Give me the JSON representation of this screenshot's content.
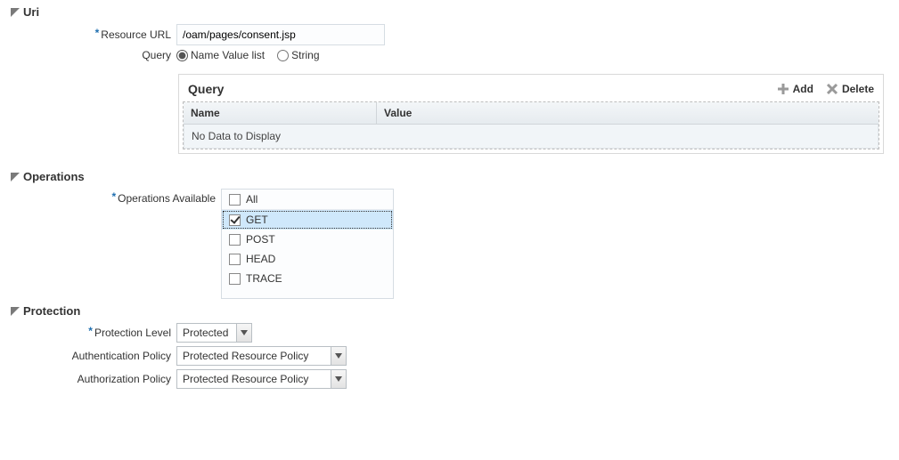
{
  "uri": {
    "section_title": "Uri",
    "resource_url_label": "Resource URL",
    "resource_url_value": "/oam/pages/consent.jsp",
    "query_label": "Query",
    "query_options": {
      "nvl": "Name Value list",
      "str": "String"
    },
    "query_selected": "nvl",
    "query_panel": {
      "title": "Query",
      "add_label": "Add",
      "delete_label": "Delete",
      "columns": {
        "name": "Name",
        "value": "Value"
      },
      "empty_text": "No Data to Display"
    }
  },
  "operations": {
    "section_title": "Operations",
    "available_label": "Operations Available",
    "all_label": "All",
    "items": [
      {
        "label": "GET",
        "checked": true,
        "selected": true
      },
      {
        "label": "POST",
        "checked": false,
        "selected": false
      },
      {
        "label": "HEAD",
        "checked": false,
        "selected": false
      },
      {
        "label": "TRACE",
        "checked": false,
        "selected": false
      }
    ]
  },
  "protection": {
    "section_title": "Protection",
    "level_label": "Protection Level",
    "level_value": "Protected",
    "authn_label": "Authentication Policy",
    "authn_value": "Protected Resource Policy",
    "authz_label": "Authorization Policy",
    "authz_value": "Protected Resource Policy"
  }
}
